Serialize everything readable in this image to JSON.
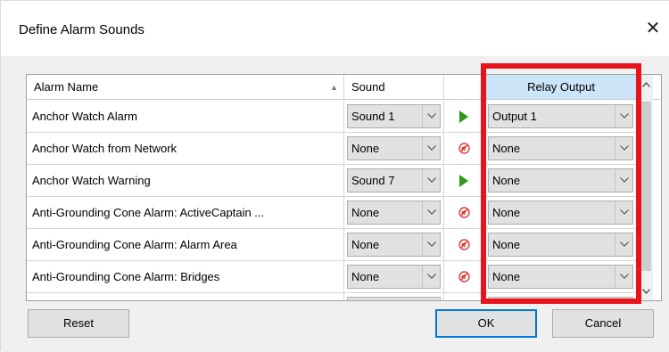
{
  "dialog": {
    "title": "Define Alarm Sounds",
    "close_glyph": "✕"
  },
  "grid": {
    "headers": {
      "name": "Alarm Name",
      "sound": "Sound",
      "relay": "Relay Output"
    },
    "rows": [
      {
        "name": "Anchor Watch Alarm",
        "sound": "Sound 1",
        "playable": true,
        "relay": "Output 1"
      },
      {
        "name": "Anchor Watch from Network",
        "sound": "None",
        "playable": false,
        "relay": "None"
      },
      {
        "name": "Anchor Watch Warning",
        "sound": "Sound 7",
        "playable": true,
        "relay": "None"
      },
      {
        "name": "Anti-Grounding Cone Alarm: ActiveCaptain ...",
        "sound": "None",
        "playable": false,
        "relay": "None"
      },
      {
        "name": "Anti-Grounding Cone Alarm: Alarm Area",
        "sound": "None",
        "playable": false,
        "relay": "None"
      },
      {
        "name": "Anti-Grounding Cone Alarm: Bridges",
        "sound": "None",
        "playable": false,
        "relay": "None"
      }
    ]
  },
  "buttons": {
    "reset": "Reset",
    "ok": "OK",
    "cancel": "Cancel"
  },
  "colors": {
    "relay_header_bg": "#cce4f7",
    "highlight_border": "#e8141c",
    "play_icon": "#2e9a1b",
    "mute_icon": "#e03c3c",
    "default_button_border": "#0078d7"
  },
  "icons": {
    "play": "play-icon",
    "mute": "speaker-muted-icon",
    "dropdown": "chevron-down-icon",
    "sort": "sort-ascending-icon",
    "close": "close-icon"
  }
}
